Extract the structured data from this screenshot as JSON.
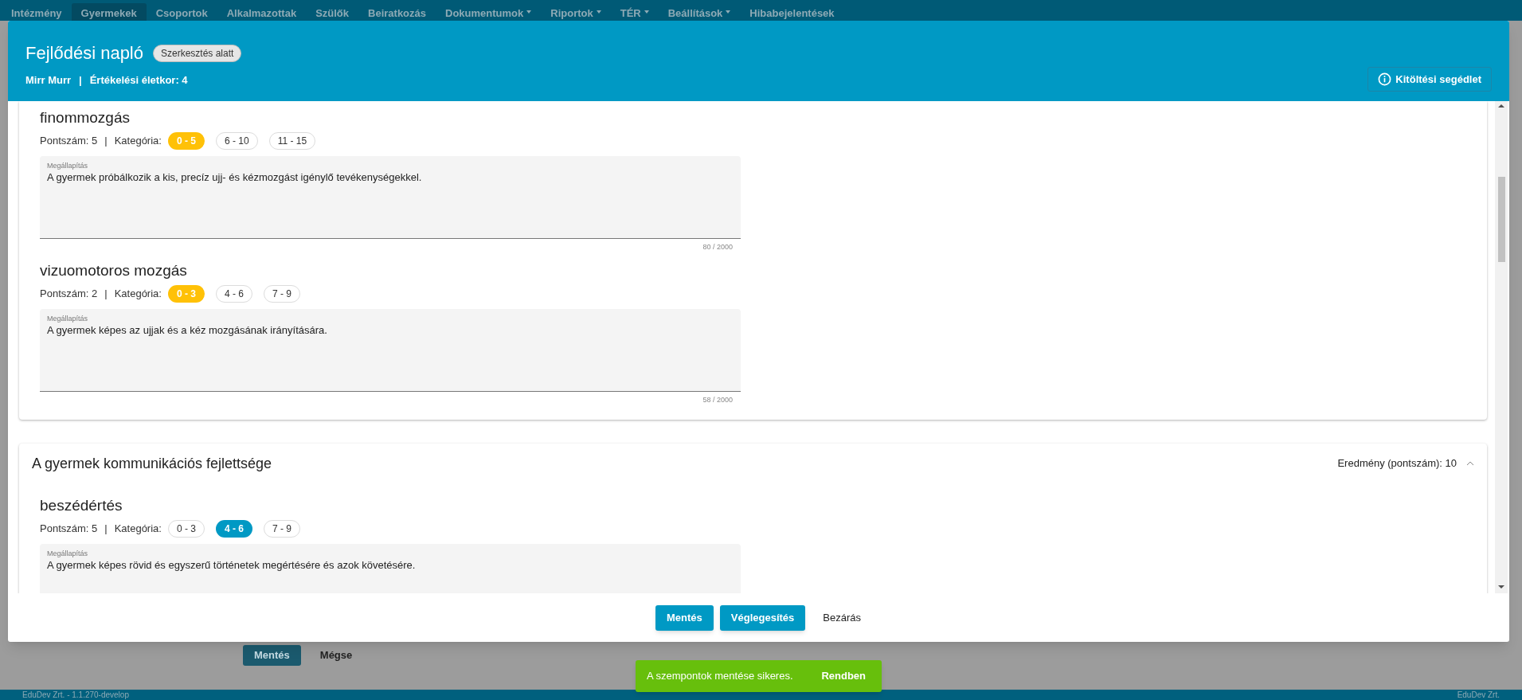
{
  "nav": [
    {
      "label": "Intézmény",
      "selected": false,
      "dropdown": false
    },
    {
      "label": "Gyermekek",
      "selected": true,
      "dropdown": false
    },
    {
      "label": "Csoportok",
      "selected": false,
      "dropdown": false
    },
    {
      "label": "Alkalmazottak",
      "selected": false,
      "dropdown": false
    },
    {
      "label": "Szülők",
      "selected": false,
      "dropdown": false
    },
    {
      "label": "Beiratkozás",
      "selected": false,
      "dropdown": false
    },
    {
      "label": "Dokumentumok",
      "selected": false,
      "dropdown": true
    },
    {
      "label": "Riportok",
      "selected": false,
      "dropdown": true
    },
    {
      "label": "TÉR",
      "selected": false,
      "dropdown": true
    },
    {
      "label": "Beállítások",
      "selected": false,
      "dropdown": true
    },
    {
      "label": "Hibabejelentések",
      "selected": false,
      "dropdown": false
    }
  ],
  "page": {
    "buttons": [
      {
        "label": "Mentés",
        "kind": "primary"
      },
      {
        "label": "Mégse",
        "kind": "text"
      }
    ],
    "footer_left": "EduDev Zrt. - 1.1.270-develop",
    "footer_right": "EduDev Zrt."
  },
  "dialog": {
    "title": "Fejlődési napló",
    "status_badge": "Szerkesztés alatt",
    "child_name": "Mirr Murr",
    "separator": "|",
    "age_label": "Értékelési életkor: 4",
    "help_button": "Kitöltési segédlet",
    "sections": [
      {
        "items": [
          {
            "name": "finommozgás",
            "score": "Pontszám: 5",
            "separator": "|",
            "category_label": "Kategória:",
            "categories": [
              {
                "label": "0 - 5",
                "selected": true,
                "color": "#ffc107"
              },
              {
                "label": "6 - 10",
                "selected": false
              },
              {
                "label": "11 - 15",
                "selected": false
              }
            ],
            "field_label": "Megállapítás",
            "value": "A gyermek próbálkozik a kis, precíz ujj- és kézmozgást igénylő tevékenységekkel.",
            "counter": "80 / 2000"
          },
          {
            "name": "vizuomotoros mozgás",
            "score": "Pontszám: 2",
            "separator": "|",
            "category_label": "Kategória:",
            "categories": [
              {
                "label": "0 - 3",
                "selected": true,
                "color": "#ffc107"
              },
              {
                "label": "4 - 6",
                "selected": false
              },
              {
                "label": "7 - 9",
                "selected": false
              }
            ],
            "field_label": "Megállapítás",
            "value": "A gyermek képes az ujjak és a kéz mozgásának irányítására.",
            "counter": "58 / 2000"
          }
        ]
      },
      {
        "title": "A gyermek kommunikációs fejlettsége",
        "result": "Eredmény (pontszám): 10",
        "expanded": true,
        "items": [
          {
            "name": "beszédértés",
            "score": "Pontszám: 5",
            "separator": "|",
            "category_label": "Kategória:",
            "categories": [
              {
                "label": "0 - 3",
                "selected": false
              },
              {
                "label": "4 - 6",
                "selected": true,
                "color": "#0099c4"
              },
              {
                "label": "7 - 9",
                "selected": false
              }
            ],
            "field_label": "Megállapítás",
            "value": "A gyermek képes rövid és egyszerű történetek megértésére és azok követésére."
          }
        ]
      }
    ],
    "buttons": [
      {
        "label": "Mentés",
        "kind": "primary"
      },
      {
        "label": "Véglegesítés",
        "kind": "primary"
      },
      {
        "label": "Bezárás",
        "kind": "text"
      }
    ]
  },
  "toast": {
    "message": "A szempontok mentése sikeres.",
    "action": "Rendben"
  }
}
